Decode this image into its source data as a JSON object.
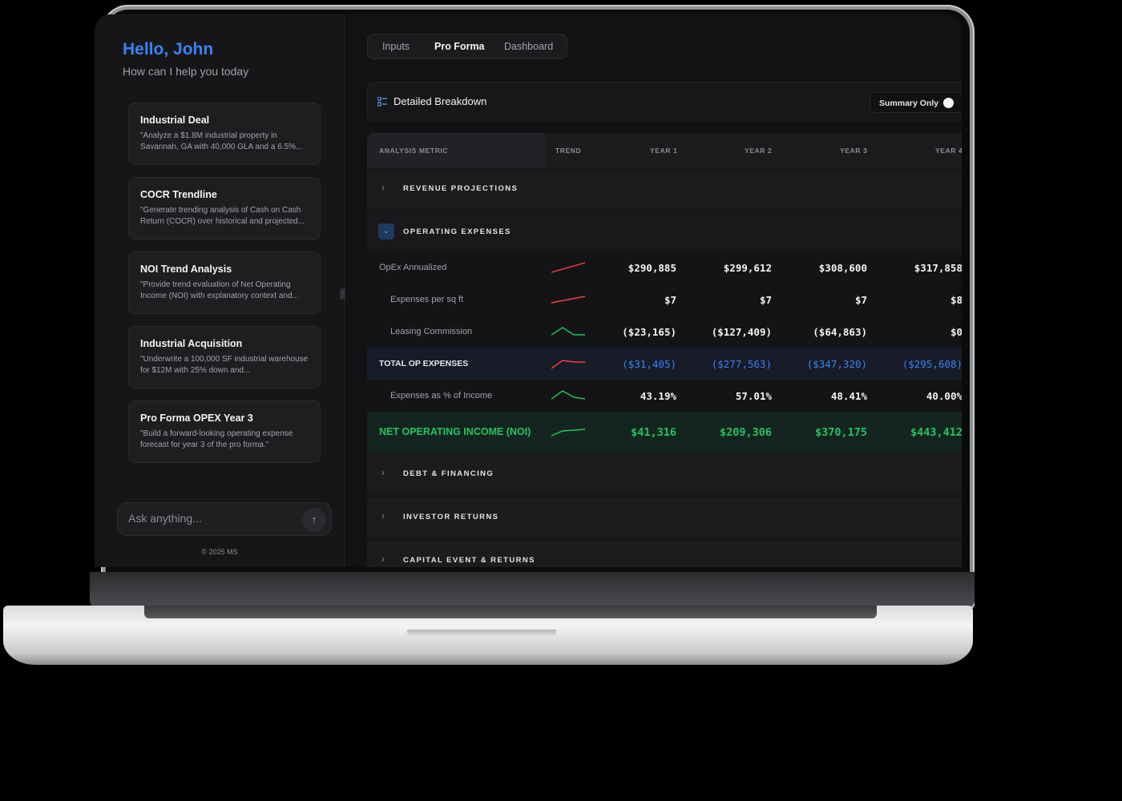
{
  "sidebar": {
    "greeting": "Hello, John",
    "subtitle": "How can I help you today",
    "cards": [
      {
        "title": "Industrial Deal",
        "desc": "\"Analyze a $1.8M industrial property in Savannah, GA with 40,000 GLA and a 6.5%..."
      },
      {
        "title": "COCR Trendline",
        "desc": "\"Generate trending analysis of Cash on Cash Return (COCR) over historical and projected..."
      },
      {
        "title": "NOI Trend Analysis",
        "desc": "\"Provide trend evaluation of Net Operating Income (NOI) with explanatory context and..."
      },
      {
        "title": "Industrial Acquisition",
        "desc": "\"Underwrite a 100,000 SF industrial warehouse for $12M with 25% down and..."
      },
      {
        "title": "Pro Forma OPEX Year 3",
        "desc": "\"Build a forward-looking operating expense forecast for year 3 of the pro forma.\""
      }
    ],
    "chat_placeholder": "Ask anything...",
    "send_icon": "arrow-up-icon",
    "copyright": "© 2025 MS"
  },
  "tabs": [
    {
      "label": "Inputs",
      "active": false
    },
    {
      "label": "Pro Forma",
      "active": true
    },
    {
      "label": "Dashboard",
      "active": false
    }
  ],
  "breakdown": {
    "icon": "list-icon",
    "title": "Detailed Breakdown",
    "summary_label": "Summary Only",
    "summary_toggle_on": false
  },
  "table": {
    "headers": [
      "ANALYSIS METRIC",
      "TREND",
      "YEAR 1",
      "YEAR 2",
      "YEAR 3",
      "YEAR 4"
    ],
    "sections": {
      "revenue": "REVENUE PROJECTIONS",
      "opex": "OPERATING EXPENSES",
      "debt": "DEBT & FINANCING",
      "returns": "INVESTOR RETURNS",
      "capital": "CAPITAL EVENT & RETURNS"
    },
    "rows": [
      {
        "label": "OpEx Annualized",
        "trend": "up-red",
        "values": [
          "$290,885",
          "$299,612",
          "$308,600",
          "$317,858"
        ]
      },
      {
        "label": "Expenses per sq ft",
        "trend": "up-red",
        "values": [
          "$7",
          "$7",
          "$7",
          "$8"
        ]
      },
      {
        "label": "Leasing Commission",
        "trend": "hump-green",
        "values": [
          "($23,165)",
          "($127,409)",
          "($64,863)",
          "$0"
        ]
      },
      {
        "label": "TOTAL OP EXPENSES",
        "trend": "hump-red",
        "values": [
          "($31,405)",
          "($277,563)",
          "($347,320)",
          "($295,608)"
        ]
      },
      {
        "label": "Expenses as % of Income",
        "trend": "hump-green",
        "values": [
          "43.19%",
          "57.01%",
          "48.41%",
          "40.00%"
        ]
      },
      {
        "label": "NET OPERATING INCOME (NOI)",
        "trend": "up-green",
        "values": [
          "$41,316",
          "$209,306",
          "$370,175",
          "$443,412"
        ]
      }
    ]
  },
  "colors": {
    "accent_blue": "#3b82f6",
    "positive_green": "#22c55e",
    "trend_red": "#ef4444"
  }
}
